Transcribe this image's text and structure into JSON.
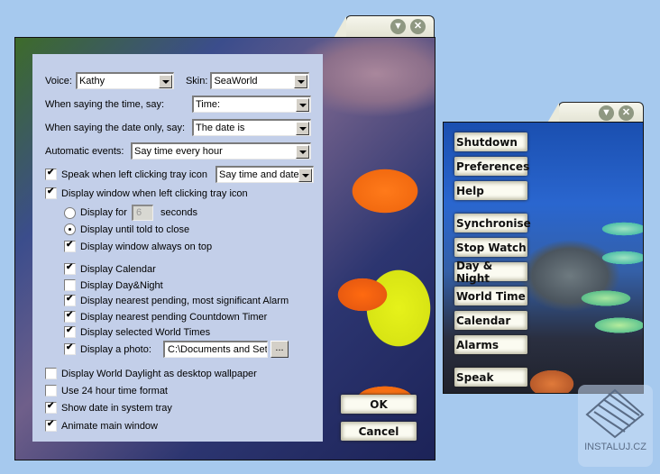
{
  "main_window": {
    "title_buttons": {
      "minimize_icon": "▼",
      "close_icon": "✕"
    },
    "voice": {
      "label": "Voice:",
      "value": "Kathy"
    },
    "skin": {
      "label": "Skin:",
      "value": "SeaWorld"
    },
    "time_say": {
      "label": "When saying the time, say:",
      "value": "Time:"
    },
    "date_say": {
      "label": "When saying the date only, say:",
      "value": "The date is"
    },
    "auto_events": {
      "label": "Automatic events:",
      "value": "Say time every hour"
    },
    "speak_click": {
      "label": "Speak when left clicking tray icon",
      "checked": true,
      "value": "Say time and date"
    },
    "display_window": {
      "label": "Display window when left clicking tray icon",
      "checked": true
    },
    "display_for": {
      "label": "Display for",
      "value": "6",
      "suffix": "seconds",
      "selected": false
    },
    "display_until": {
      "label": "Display until told to close",
      "selected": true
    },
    "always_on_top": {
      "label": "Display window always on top",
      "checked": true
    },
    "show_items": [
      {
        "label": "Display Calendar",
        "checked": true
      },
      {
        "label": "Display Day&Night",
        "checked": false
      },
      {
        "label": "Display nearest pending, most significant Alarm",
        "checked": true
      },
      {
        "label": "Display nearest pending Countdown Timer",
        "checked": true
      },
      {
        "label": "Display selected World Times",
        "checked": true
      }
    ],
    "photo": {
      "label": "Display a photo:",
      "checked": true,
      "path": "C:\\Documents and Settings",
      "browse_label": "..."
    },
    "bottom_options": [
      {
        "label": "Display World Daylight as desktop wallpaper",
        "checked": false
      },
      {
        "label": "Use 24 hour time format",
        "checked": false
      },
      {
        "label": "Show date in system tray",
        "checked": true
      },
      {
        "label": "Animate main window",
        "checked": true
      }
    ],
    "ok_label": "OK",
    "cancel_label": "Cancel"
  },
  "menu_window": {
    "title_buttons": {
      "minimize_icon": "▼",
      "close_icon": "✕"
    },
    "items": [
      "Shutdown",
      "Preferences",
      "Help",
      "Synchronise",
      "Stop Watch",
      "Day & Night",
      "World Time",
      "Calendar",
      "Alarms",
      "Speak"
    ]
  },
  "watermark": {
    "text": "INSTALUJ.CZ"
  }
}
